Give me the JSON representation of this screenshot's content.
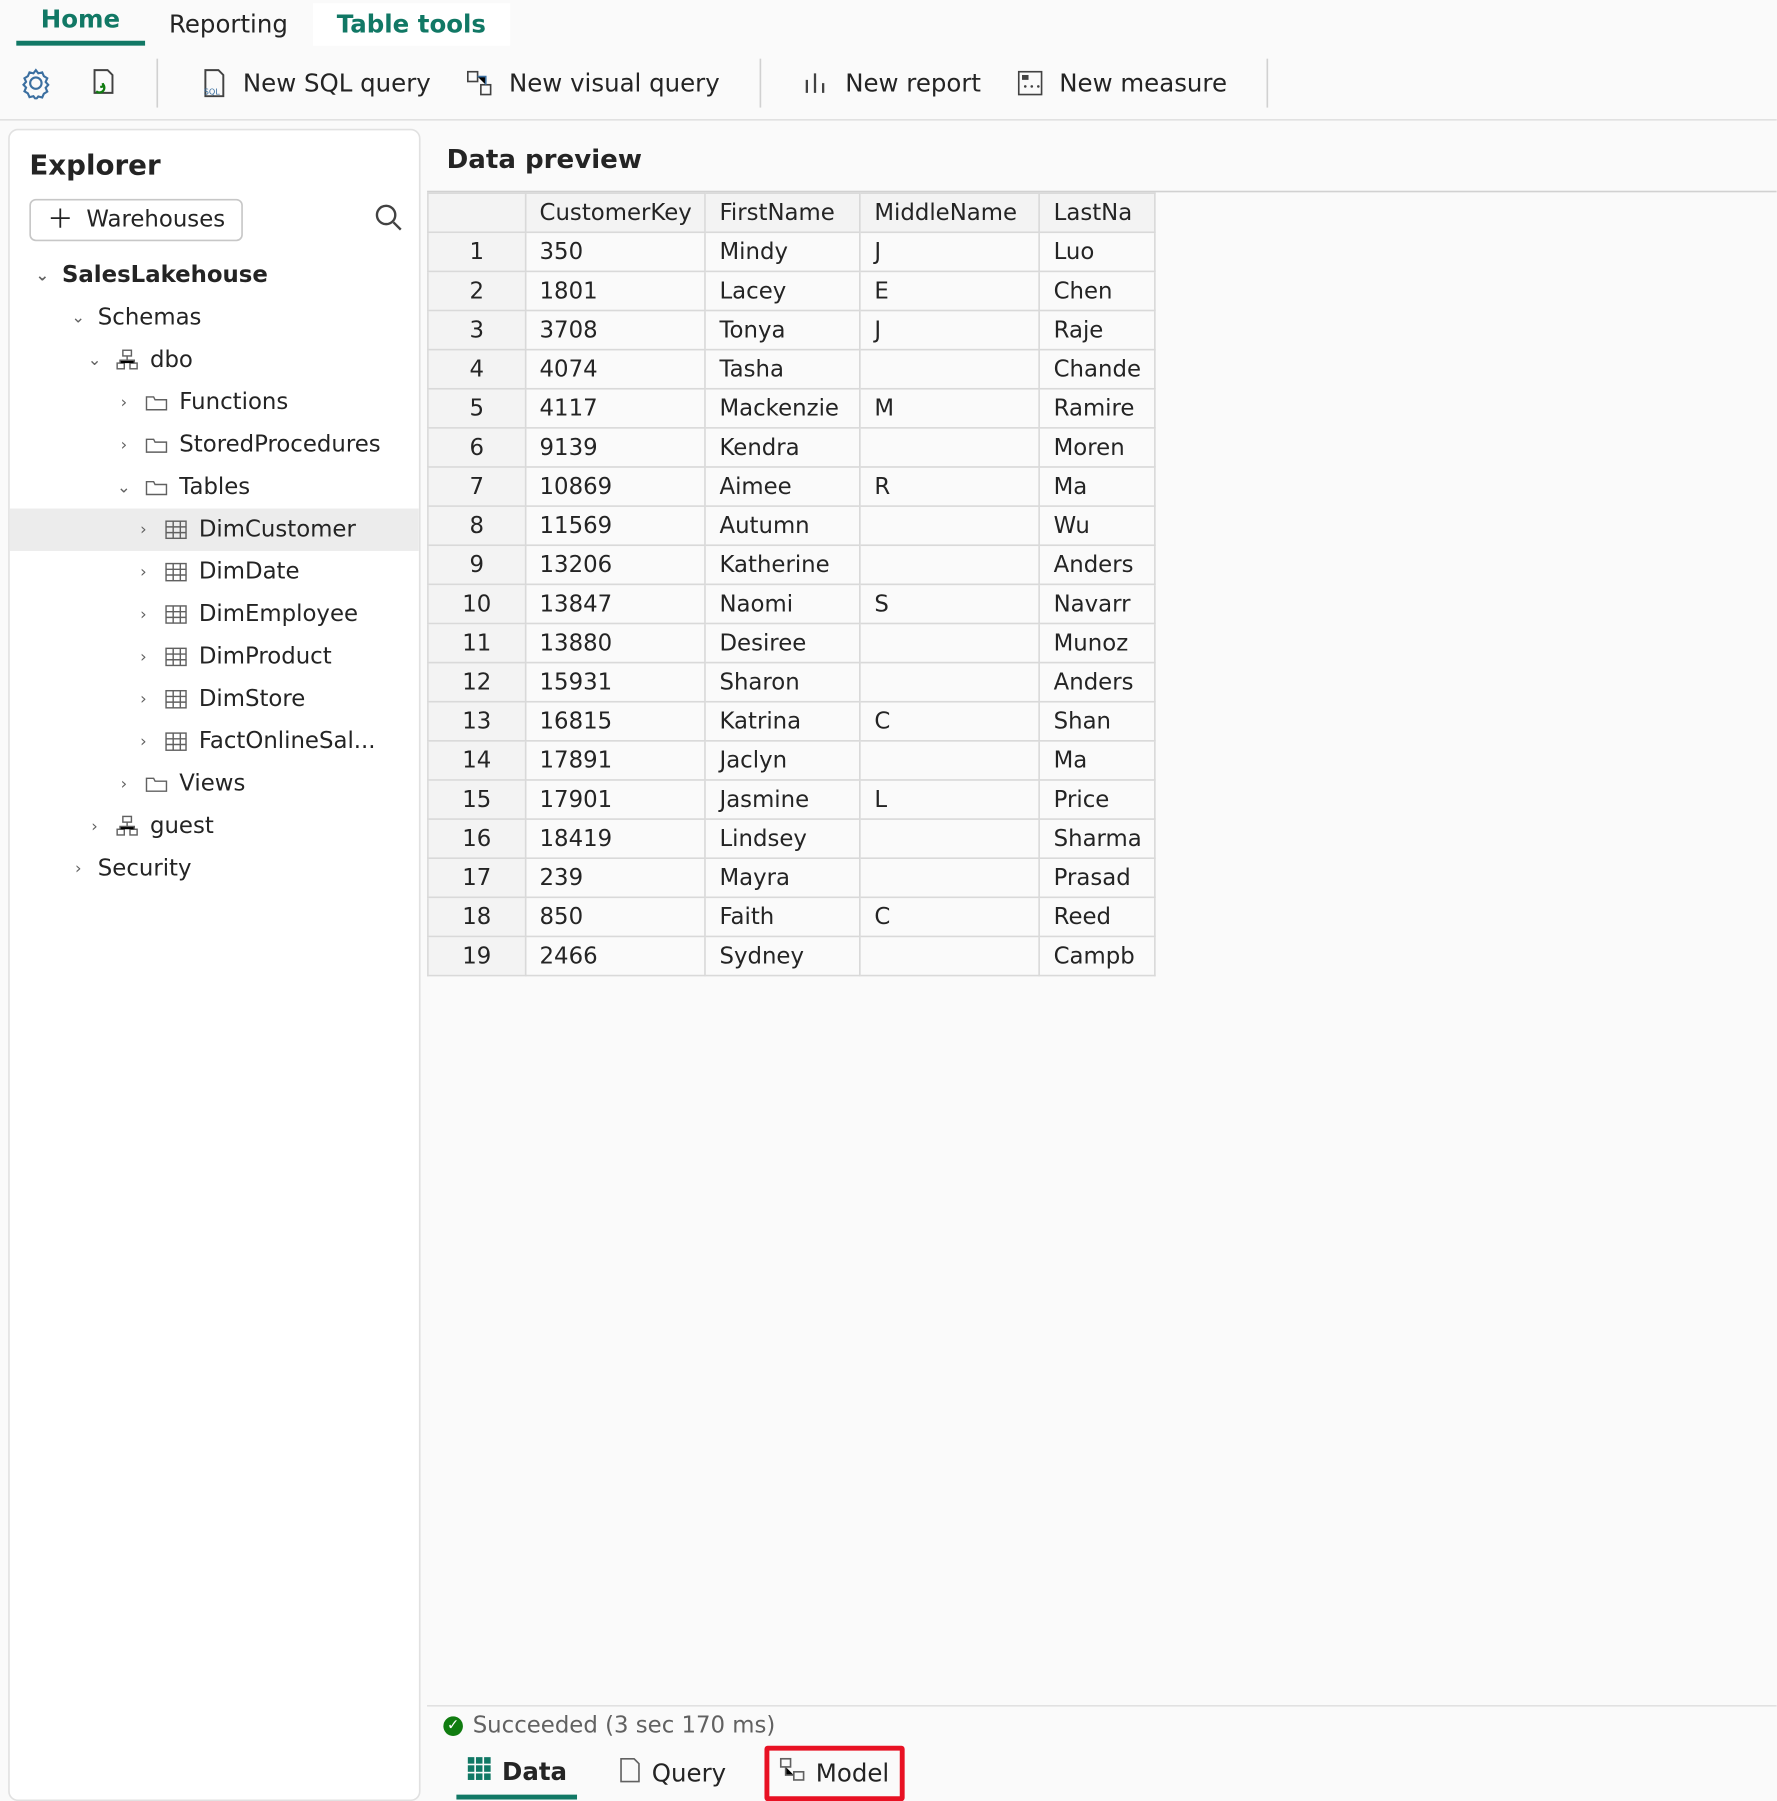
{
  "ribbon": {
    "tabs": [
      "Home",
      "Reporting",
      "Table tools"
    ],
    "active": 0,
    "highlight": 2,
    "buttons": {
      "new_sql": "New SQL query",
      "new_visual": "New visual query",
      "new_report": "New report",
      "new_measure": "New measure"
    }
  },
  "explorer": {
    "title": "Explorer",
    "warehouses_btn": "Warehouses",
    "root": "SalesLakehouse",
    "schemas_label": "Schemas",
    "dbo_label": "dbo",
    "functions_label": "Functions",
    "storedprocs_label": "StoredProcedures",
    "tables_label": "Tables",
    "views_label": "Views",
    "guest_label": "guest",
    "security_label": "Security",
    "tables": [
      "DimCustomer",
      "DimDate",
      "DimEmployee",
      "DimProduct",
      "DimStore",
      "FactOnlineSal..."
    ],
    "selected_table": "DimCustomer"
  },
  "preview": {
    "title": "Data preview",
    "columns": [
      "CustomerKey",
      "FirstName",
      "MiddleName",
      "LastNa"
    ],
    "rows": [
      {
        "n": 1,
        "CustomerKey": "350",
        "FirstName": "Mindy",
        "MiddleName": "J",
        "LastName": "Luo"
      },
      {
        "n": 2,
        "CustomerKey": "1801",
        "FirstName": "Lacey",
        "MiddleName": "E",
        "LastName": "Chen"
      },
      {
        "n": 3,
        "CustomerKey": "3708",
        "FirstName": "Tonya",
        "MiddleName": "J",
        "LastName": "Raje"
      },
      {
        "n": 4,
        "CustomerKey": "4074",
        "FirstName": "Tasha",
        "MiddleName": "",
        "LastName": "Chande"
      },
      {
        "n": 5,
        "CustomerKey": "4117",
        "FirstName": "Mackenzie",
        "MiddleName": "M",
        "LastName": "Ramire"
      },
      {
        "n": 6,
        "CustomerKey": "9139",
        "FirstName": "Kendra",
        "MiddleName": "",
        "LastName": "Moren"
      },
      {
        "n": 7,
        "CustomerKey": "10869",
        "FirstName": "Aimee",
        "MiddleName": "R",
        "LastName": "Ma"
      },
      {
        "n": 8,
        "CustomerKey": "11569",
        "FirstName": "Autumn",
        "MiddleName": "",
        "LastName": "Wu"
      },
      {
        "n": 9,
        "CustomerKey": "13206",
        "FirstName": "Katherine",
        "MiddleName": "",
        "LastName": "Anders"
      },
      {
        "n": 10,
        "CustomerKey": "13847",
        "FirstName": "Naomi",
        "MiddleName": "S",
        "LastName": "Navarr"
      },
      {
        "n": 11,
        "CustomerKey": "13880",
        "FirstName": "Desiree",
        "MiddleName": "",
        "LastName": "Munoz"
      },
      {
        "n": 12,
        "CustomerKey": "15931",
        "FirstName": "Sharon",
        "MiddleName": "",
        "LastName": "Anders"
      },
      {
        "n": 13,
        "CustomerKey": "16815",
        "FirstName": "Katrina",
        "MiddleName": "C",
        "LastName": "Shan"
      },
      {
        "n": 14,
        "CustomerKey": "17891",
        "FirstName": "Jaclyn",
        "MiddleName": "",
        "LastName": "Ma"
      },
      {
        "n": 15,
        "CustomerKey": "17901",
        "FirstName": "Jasmine",
        "MiddleName": "L",
        "LastName": "Price"
      },
      {
        "n": 16,
        "CustomerKey": "18419",
        "FirstName": "Lindsey",
        "MiddleName": "",
        "LastName": "Sharma"
      },
      {
        "n": 17,
        "CustomerKey": "239",
        "FirstName": "Mayra",
        "MiddleName": "",
        "LastName": "Prasad"
      },
      {
        "n": 18,
        "CustomerKey": "850",
        "FirstName": "Faith",
        "MiddleName": "C",
        "LastName": "Reed"
      },
      {
        "n": 19,
        "CustomerKey": "2466",
        "FirstName": "Sydney",
        "MiddleName": "",
        "LastName": "Campb"
      }
    ],
    "status": "Succeeded (3 sec 170 ms)"
  },
  "bottom_tabs": {
    "data": "Data",
    "query": "Query",
    "model": "Model",
    "active": "Data",
    "highlighted": "Model"
  }
}
